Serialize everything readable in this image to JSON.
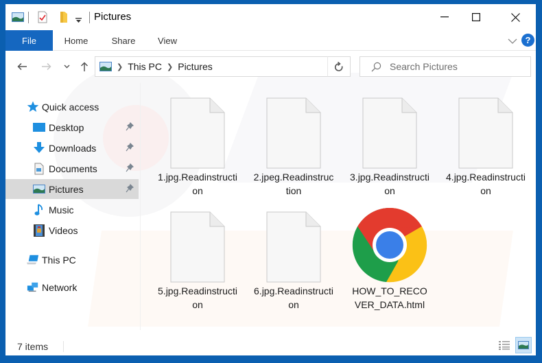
{
  "window": {
    "title": "Pictures",
    "controls": {
      "minimize": "minimize",
      "maximize": "maximize",
      "close": "close"
    }
  },
  "quick_access_toolbar": {
    "icons": [
      "pictures-folder-icon",
      "properties-icon",
      "new-folder-icon",
      "customize-dropdown-icon"
    ]
  },
  "ribbon": {
    "tabs": [
      {
        "label": "File",
        "active": true
      },
      {
        "label": "Home"
      },
      {
        "label": "Share"
      },
      {
        "label": "View"
      }
    ],
    "help_label": "?"
  },
  "navigation": {
    "breadcrumb": [
      "This PC",
      "Pictures"
    ],
    "search_placeholder": "Search Pictures"
  },
  "sidebar": {
    "items": [
      {
        "label": "Quick access",
        "icon": "star-icon",
        "pinned": false
      },
      {
        "label": "Desktop",
        "icon": "desktop-icon",
        "pinned": true
      },
      {
        "label": "Downloads",
        "icon": "download-icon",
        "pinned": true
      },
      {
        "label": "Documents",
        "icon": "documents-icon",
        "pinned": true
      },
      {
        "label": "Pictures",
        "icon": "pictures-icon",
        "pinned": true,
        "selected": true
      },
      {
        "label": "Music",
        "icon": "music-icon",
        "pinned": false
      },
      {
        "label": "Videos",
        "icon": "videos-icon",
        "pinned": false
      },
      {
        "label": "This PC",
        "icon": "computer-icon",
        "pinned": false
      },
      {
        "label": "Network",
        "icon": "network-icon",
        "pinned": false
      }
    ]
  },
  "files": [
    {
      "name": "1.jpg.Readinstruction",
      "type": "generic"
    },
    {
      "name": "2.jpeg.Readinstruction",
      "type": "generic"
    },
    {
      "name": "3.jpg.Readinstruction",
      "type": "generic"
    },
    {
      "name": "4.jpg.Readinstruction",
      "type": "generic"
    },
    {
      "name": "5.jpg.Readinstruction",
      "type": "generic"
    },
    {
      "name": "6.jpg.Readinstruction",
      "type": "generic"
    },
    {
      "name": "HOW_TO_RECOVER_DATA.html",
      "type": "chrome-html"
    }
  ],
  "status_bar": {
    "item_count": "7 items"
  },
  "colors": {
    "accent": "#1567c0",
    "frame": "#0b5fb0",
    "selected_bg": "#d9d9d9"
  }
}
